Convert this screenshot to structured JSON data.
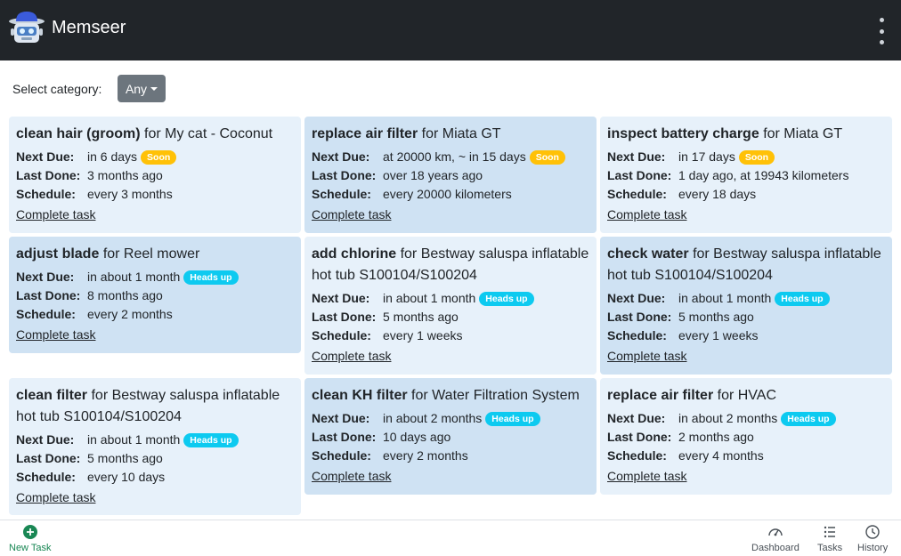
{
  "header": {
    "app_name": "Memseer"
  },
  "filter": {
    "label": "Select category:",
    "value": "Any"
  },
  "labels": {
    "next_due": "Next Due:",
    "last_done": "Last Done:",
    "schedule": "Schedule:",
    "complete": "Complete task"
  },
  "tasks": [
    {
      "action": "clean hair (groom)",
      "target": "for My cat - Coconut",
      "next_due": "in 6 days",
      "badge": "Soon",
      "last_done": "3 months ago",
      "schedule": "every 3 months"
    },
    {
      "action": "replace air filter",
      "target": "for Miata GT",
      "next_due": "at 20000 km, ~ in 15 days",
      "badge": "Soon",
      "last_done": "over 18 years ago",
      "schedule": "every 20000 kilometers"
    },
    {
      "action": "inspect battery charge",
      "target": "for Miata GT",
      "next_due": "in 17 days",
      "badge": "Soon",
      "last_done": "1 day ago, at 19943 kilometers",
      "schedule": "every 18 days"
    },
    {
      "action": "adjust blade",
      "target": "for Reel mower",
      "next_due": "in about 1 month",
      "badge": "Heads up",
      "last_done": "8 months ago",
      "schedule": "every 2 months"
    },
    {
      "action": "add chlorine",
      "target": "for Bestway saluspa inflatable hot tub S100104/S100204",
      "next_due": "in about 1 month",
      "badge": "Heads up",
      "last_done": "5 months ago",
      "schedule": "every 1 weeks"
    },
    {
      "action": "check water",
      "target": "for Bestway saluspa inflatable hot tub S100104/S100204",
      "next_due": "in about 1 month",
      "badge": "Heads up",
      "last_done": "5 months ago",
      "schedule": "every 1 weeks"
    },
    {
      "action": "clean filter",
      "target": "for Bestway saluspa inflatable hot tub S100104/S100204",
      "next_due": "in about 1 month",
      "badge": "Heads up",
      "last_done": "5 months ago",
      "schedule": "every 10 days"
    },
    {
      "action": "clean KH filter",
      "target": "for Water Filtration System",
      "next_due": "in about 2 months",
      "badge": "Heads up",
      "last_done": "10 days ago",
      "schedule": "every 2 months"
    },
    {
      "action": "replace air filter",
      "target": "for HVAC",
      "next_due": "in about 2 months",
      "badge": "Heads up",
      "last_done": "2 months ago",
      "schedule": "every 4 months"
    }
  ],
  "bottom_nav": {
    "new_task": "New Task",
    "dashboard": "Dashboard",
    "tasks": "Tasks",
    "history": "History"
  },
  "colors": {
    "header_bg": "#212529",
    "card_light": "#e7f1fa",
    "card_dark": "#cfe2f3",
    "soon_badge": "#ffc107",
    "heads_up_badge": "#0dcaf0",
    "new_task_green": "#198754"
  }
}
